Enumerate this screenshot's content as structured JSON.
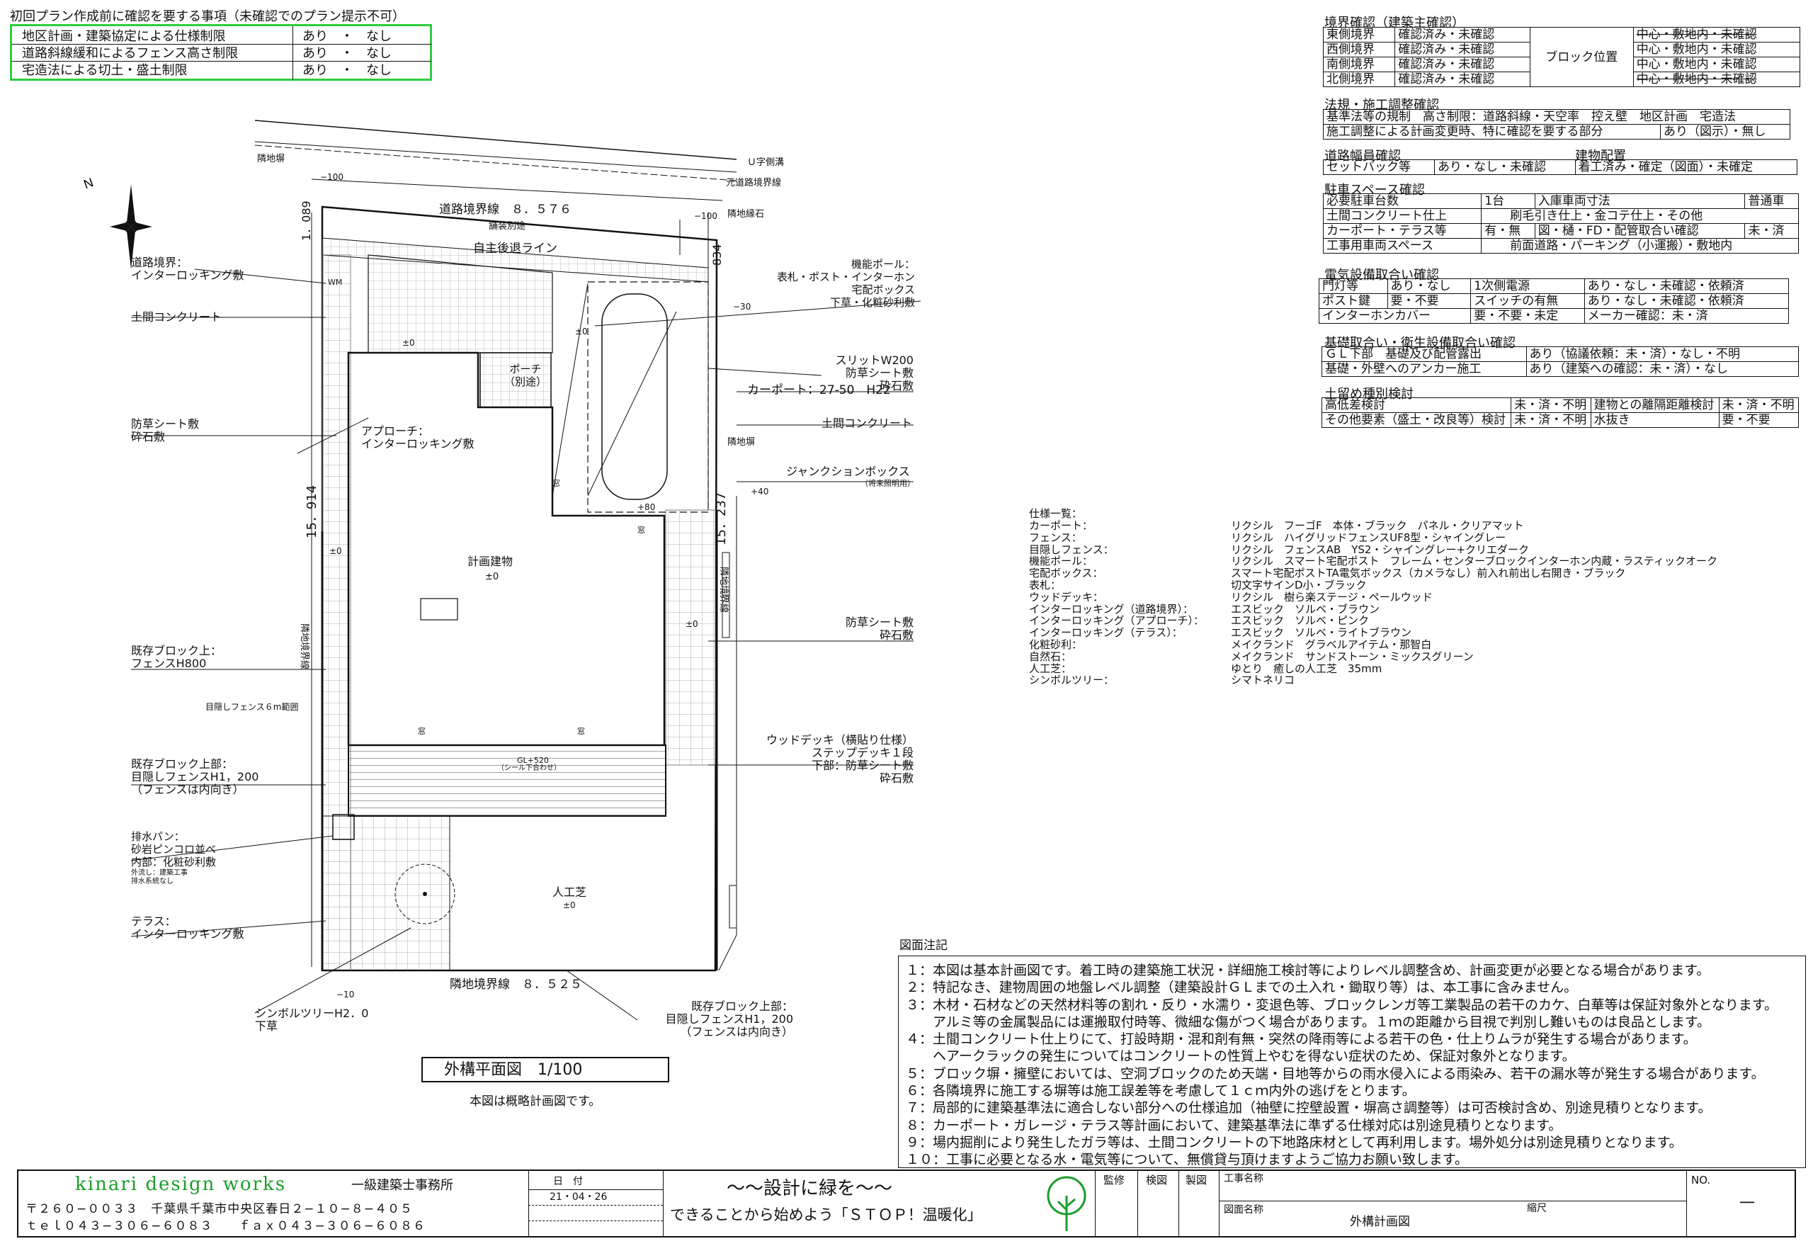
{
  "header_warning": {
    "title": "初回プラン作成前に確認を要する事項（未確認でのプラン提示不可）",
    "rows": [
      {
        "item": "地区計画・建築協定による仕様制限",
        "options": "あり　・　なし"
      },
      {
        "item": "道路斜線緩和によるフェンス高さ制限",
        "options": "あり　・　なし"
      },
      {
        "item": "宅造法による切土・盛土制限",
        "options": "あり　・　なし"
      }
    ]
  },
  "boundary": {
    "title": "境界確認（建築主確認）",
    "block_label": "ブロック位置",
    "rows": [
      {
        "side": "東側境界",
        "status": "確認済み・未確認",
        "pos": "中心・敷地内・未確認"
      },
      {
        "side": "西側境界",
        "status": "確認済み・未確認",
        "pos": "中心・敷地内・未確認"
      },
      {
        "side": "南側境界",
        "status": "確認済み・未確認",
        "pos": "中心・敷地内・未確認"
      },
      {
        "side": "北側境界",
        "status": "確認済み・未確認",
        "pos": "中心・敷地内・未確認"
      }
    ]
  },
  "law": {
    "title": "法規・施工調整確認",
    "row1": "基準法等の規制　高さ制限：道路斜線・天空率　控え壁　地区計画　宅造法",
    "row2a": "施工調整による計画変更時、特に確認を要する部分",
    "row2b": "あり（図示）・無し"
  },
  "road": {
    "title": "道路幅員確認",
    "title2": "建物配置",
    "c1": "セットバック等",
    "c2": "あり・なし・未確認",
    "c3": "着工済み・確定（図面）・未確定"
  },
  "parking": {
    "title": "駐車スペース確認",
    "rows": [
      [
        "必要駐車台数",
        "1台",
        "入庫車両寸法",
        "普通車"
      ],
      [
        "土間コンクリート仕上",
        "刷毛引き仕上・金コテ仕上・その他"
      ],
      [
        "カーポート・テラス等",
        "有・無",
        "図・樋・FD・配管取合い確認",
        "未・済"
      ],
      [
        "工事用車両スペース",
        "前面道路・パーキング（小運搬）・敷地内"
      ]
    ]
  },
  "electric": {
    "title": "電気設備取合い確認",
    "rows": [
      [
        "門灯等",
        "あり・なし",
        "1次側電源",
        "あり・なし・未確認・依頼済"
      ],
      [
        "ポスト鍵",
        "要・不要",
        "スイッチの有無",
        "あり・なし・未確認・依頼済"
      ],
      [
        "インターホンカバー",
        "要・不要・未定",
        "メーカー確認：未・済"
      ]
    ]
  },
  "foundation": {
    "title": "基礎取合い・衛生設備取合い確認",
    "rows": [
      [
        "ＧＬ下部　基礎及び配管露出",
        "あり（協議依頼：未・済）・なし・不明"
      ],
      [
        "基礎・外壁へのアンカー施工",
        "あり（建築への確認：未・済）・なし"
      ]
    ]
  },
  "retain": {
    "title": "土留め種別検討",
    "rows": [
      [
        "高低差検討",
        "未・済・不明",
        "建物との離隔距離検討",
        "未・済・不明"
      ],
      [
        "その他要素（盛土・改良等）検討",
        "未・済・不明",
        "水抜き",
        "要・不要"
      ]
    ]
  },
  "plan_labels": {
    "neighbor_fence": "隣地塀",
    "u_ditch": "Ｕ字側溝",
    "road_curb": "元道路境界線",
    "road_line": "道路境界線　８．５７６",
    "road_offset": "1．089",
    "existing_pave": "舗装別途",
    "neighbor_curb": "隣地縁石",
    "right_dim": "834",
    "retreat": "自主後退ライン",
    "m100a": "−100",
    "m100b": "−100",
    "m30": "−30",
    "l_road_interlock": "道路境界：\nインターロッキング敷",
    "l_concrete": "土間コンクリート",
    "l_func_pole": "機能ポール：\n表札・ポスト・インターホン\n宅配ボックス\n下草・化粧砂利敷",
    "l_slit": "スリットW200\n防草シート敷\n砕石敷",
    "l_carport": "カーポート：27-50　H22",
    "l_concrete2": "土間コンクリート",
    "l_neighbor2": "隣地塀",
    "l_junction": "ジャンクションボックス",
    "l_junction_sub": "（将来照明用）",
    "l_weed": "防草シート敷\n砕石敷",
    "l_porch": "ポーチ\n（別途）",
    "l_approach": "アプローチ：\nインターロッキング敷",
    "building": "計画建物",
    "pm0": "±0",
    "left_dim": "15．914",
    "right_dim2": "15．237",
    "left_line": "隣地境界線",
    "right_line": "隣地境界線",
    "l_weed2": "防草シート敷\n砕石敷",
    "l_block1": "既存ブロック上：\nフェンスH800",
    "l_screen6": "目隠しフェンス６m範囲",
    "l_block2": "既存ブロック上部：\n目隠しフェンスH1，200\n（フェンスは内向き）",
    "l_deck": "ウッドデッキ（横貼り仕様）\nステップデッキ１段\n下部：防草シート敷\n砕石敷",
    "gl520": "GL+520",
    "gl520_sub": "（シール下合わせ）",
    "l_drain": "排水パン：\n砂岩ピンコロ並べ\n内部：化粧砂利敷",
    "l_drain_sub": "外流し：建築工事\n排水系統なし",
    "l_terrace": "テラス：\nインターロッキング敷",
    "turf": "人工芝",
    "bottom_line": "隣地境界線　８．５２５",
    "m10": "−10",
    "l_tree": "シンボルツリーH2．0\n下草",
    "l_block3": "既存ブロック上部：\n目隠しフェンスH1，200\n（フェンスは内向き）",
    "window": "窓",
    "p80": "+80",
    "p40": "+40",
    "wm": "WM"
  },
  "plan_title": "外構平面図　1/100",
  "plan_note": "本図は概略計画図です。",
  "spec": {
    "title": "仕様一覧：",
    "rows": [
      [
        "カーポート：",
        "リクシル　フーゴF　本体・ブラック　パネル・クリアマット"
      ],
      [
        "フェンス：",
        "リクシル　ハイグリッドフェンスUF8型・シャイングレー"
      ],
      [
        "目隠しフェンス：",
        "リクシル　フェンスAB　YS2・シャイングレー+クリエダーク"
      ],
      [
        "機能ポール：",
        "リクシル　スマート宅配ポスト　フレーム・センターブロックインターホン内蔵・ラスティックオーク"
      ],
      [
        "宅配ボックス：",
        "スマート宅配ポストTA電気ボックス（カメラなし）前入れ前出し右開き・ブラック"
      ],
      [
        "表札：",
        "切文字サインD小・ブラック"
      ],
      [
        "ウッドデッキ：",
        "リクシル　樹ら楽ステージ・ペールウッド"
      ],
      [
        "インターロッキング（道路境界）：",
        "エスビック　ソルベ・ブラウン"
      ],
      [
        "インターロッキング（アプローチ）：",
        "エスビック　ソルベ・ピンク"
      ],
      [
        "インターロッキング（テラス）：",
        "エスビック　ソルベ・ライトブラウン"
      ],
      [
        "化粧砂利：",
        "メイクランド　グラベルアイテム・那智白"
      ],
      [
        "自然石：",
        "メイクランド　サンドストーン・ミックスグリーン"
      ],
      [
        "人工芝：",
        "ゆとり　癒しの人工芝　35mm"
      ],
      [
        "シンボルツリー：",
        "シマトネリコ"
      ]
    ]
  },
  "notes": {
    "title": "図面注記",
    "items": [
      "１：本図は基本計画図です。着工時の建築施工状況・詳細施工検討等によりレベル調整含め、計画変更が必要となる場合があります。",
      "２：特記なき、建物周囲の地盤レベル調整（建築設計ＧＬまでの土入れ・鋤取り等）は、本工事に含みません。",
      "３：木材・石材などの天然材料等の割れ・反り・水濡り・変退色等、ブロックレンガ等工業製品の若干のカケ、白華等は保証対象外となります。",
      "　　アルミ等の金属製品には運搬取付時等、微細な傷がつく場合があります。１ｍの距離から目視で判別し難いものは良品とします。",
      "４：土間コンクリート仕上りにて、打設時期・混和剤有無・突然の降雨等による若干の色・仕上りムラが発生する場合があります。",
      "　　ヘアークラックの発生についてはコンクリートの性質上やむを得ない症状のため、保証対象外となります。",
      "５：ブロック塀・擁壁においては、空洞ブロックのため天端・目地等からの雨水侵入による雨染み、若干の漏水等が発生する場合があります。",
      "６：各隣境界に施工する塀等は施工誤差等を考慮して１ｃｍ内外の逃げをとります。",
      "７：局部的に建築基準法に適合しない部分への仕様追加（袖壁に控壁設置・塀高さ調整等）は可否検討含め、別途見積りとなります。",
      "８：カーポート・ガレージ・テラス等計画において、建築基準法に準ずる仕様対応は別途見積りとなります。",
      "９：場内掘削により発生したガラ等は、土間コンクリートの下地路床材として再利用します。場外処分は別途見積りとなります。",
      "１０：工事に必要となる水・電気等について、無償貸与頂けますようご協力お願い致します。"
    ]
  },
  "titleblock": {
    "company": "kinari design works",
    "company_suffix": "一級建築士事務所",
    "address1": "〒２６０−００３３　千葉県千葉市中央区春日２−１０−８−４０５",
    "address2": "ｔｅｌ０４３−３０６−６０８３　　ｆａｘ０４３−３０６−６０８６",
    "date_label": "日　付",
    "date": "21・04・26",
    "slogan1": "〜〜設計に緑を〜〜",
    "slogan2": "できることから始めよう「ＳＴＯＰ！温暖化」",
    "sup": "監修",
    "check": "検図",
    "draw": "製図",
    "proj": "工事名称",
    "dwg": "図面名称",
    "dwg_name": "外構計画図",
    "scale": "縮尺",
    "no": "NO.",
    "no_val": "一"
  }
}
